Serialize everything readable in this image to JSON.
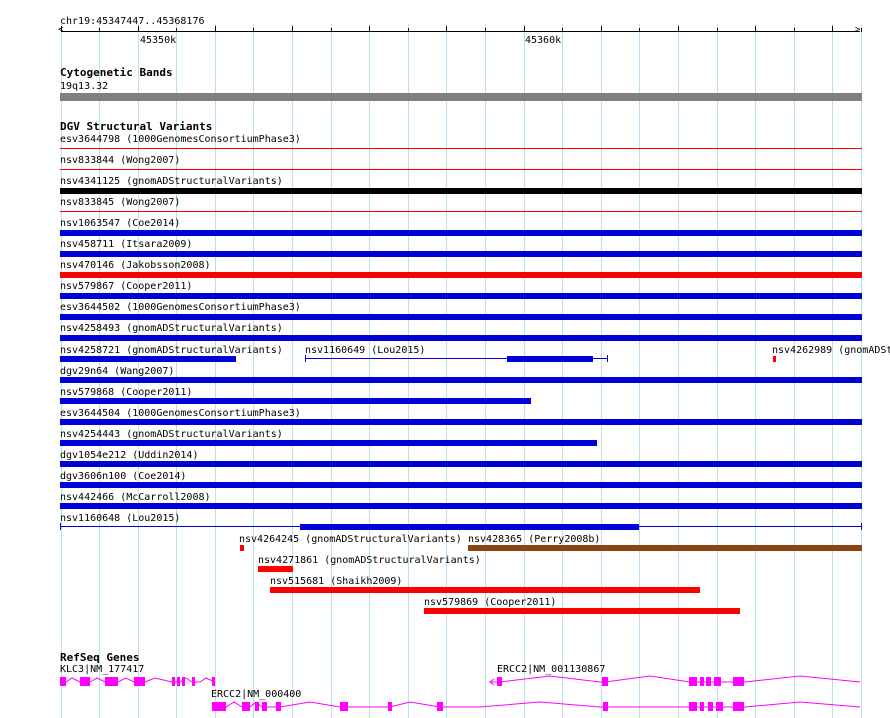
{
  "locus": "chr19:45347447..45368176",
  "ruler": {
    "tick_labels": [
      "45350k",
      "45360k"
    ]
  },
  "colors": {
    "grid": "#b9dff0",
    "ruler": "#000000",
    "cytoband": "#808080",
    "variant_loss": "#ff0000",
    "variant_gain": "#0000d8",
    "variant_complex": "#000000",
    "variant_inversion": "#8b4513",
    "gene": "#ff00ff"
  },
  "cytogenetic": {
    "title": "Cytogenetic Bands",
    "band": "19q13.32"
  },
  "dgv": {
    "title": "DGV Structural Variants",
    "rows": [
      {
        "label": "esv3644798 (1000GenomesConsortiumPhase3)"
      },
      {
        "label": "nsv833844 (Wong2007)"
      },
      {
        "label": "nsv4341125 (gnomADStructuralVariants)"
      },
      {
        "label": "nsv833845 (Wong2007)"
      },
      {
        "label": "nsv1063547 (Coe2014)"
      },
      {
        "label": "nsv458711 (Itsara2009)"
      },
      {
        "label": "nsv470146 (Jakobsson2008)"
      },
      {
        "label": "nsv579867 (Cooper2011)"
      },
      {
        "label": "esv3644502 (1000GenomesConsortiumPhase3)"
      },
      {
        "label": "nsv4258493 (gnomADStructuralVariants)"
      },
      {
        "label": "nsv4258721 (gnomADStructuralVariants)"
      },
      {
        "label": "nsv1160649 (Lou2015)"
      },
      {
        "label": "nsv4262989 (gnomADSt"
      },
      {
        "label": "dgv29n64 (Wang2007)"
      },
      {
        "label": "nsv579868 (Cooper2011)"
      },
      {
        "label": "esv3644504 (1000GenomesConsortiumPhase3)"
      },
      {
        "label": "nsv4254443 (gnomADStructuralVariants)"
      },
      {
        "label": "dgv1054e212 (Uddin2014)"
      },
      {
        "label": "dgv3606n100 (Coe2014)"
      },
      {
        "label": "nsv442466 (McCarroll2008)"
      },
      {
        "label": "nsv1160648 (Lou2015)"
      },
      {
        "label": "nsv4264245 (gnomADStructuralVariants)"
      },
      {
        "label": "nsv428365 (Perry2008b)"
      },
      {
        "label": "nsv4271861 (gnomADStructuralVariants)"
      },
      {
        "label": "nsv515681 (Shaikh2009)"
      },
      {
        "label": "nsv579869 (Cooper2011)"
      }
    ]
  },
  "refseq": {
    "title": "RefSeq Genes",
    "genes": [
      {
        "label": "KLC3|NM_177417"
      },
      {
        "label": "ERCC2|NM_001130867"
      },
      {
        "label": "ERCC2|NM_000400"
      }
    ]
  }
}
